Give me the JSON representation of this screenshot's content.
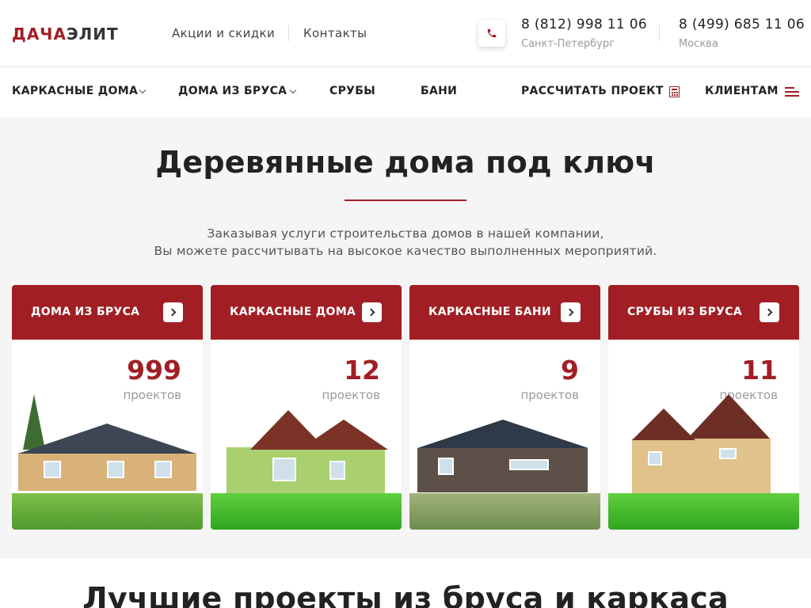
{
  "header": {
    "logo_part1": "ДАЧА",
    "logo_part2": "ЭЛИТ",
    "links": [
      "Акции и скидки",
      "Контакты"
    ],
    "phones": [
      {
        "number": "8 (812) 998 11 06",
        "city": "Санкт-Петербург"
      },
      {
        "number": "8 (499) 685 11 06",
        "city": "Москва"
      }
    ]
  },
  "nav": {
    "items": [
      "КАРКАСНЫЕ ДОМА",
      "ДОМА ИЗ БРУСА",
      "СРУБЫ",
      "БАНИ",
      "РАССЧИТАТЬ ПРОЕКТ",
      "КЛИЕНТАМ"
    ]
  },
  "hero": {
    "title": "Деревянные дома под ключ",
    "subtitle_line1": "Заказывая услуги строительства домов в нашей компании,",
    "subtitle_line2": "Вы можете рассчитывать на высокое качество выполненных мероприятий."
  },
  "cards": [
    {
      "title": "ДОМА ИЗ БРУСА",
      "count": "999",
      "unit": "проектов"
    },
    {
      "title": "КАРКАСНЫЕ ДОМА",
      "count": "12",
      "unit": "проектов"
    },
    {
      "title": "КАРКАСНЫЕ БАНИ",
      "count": "9",
      "unit": "проектов"
    },
    {
      "title": "СРУБЫ ИЗ БРУСА",
      "count": "11",
      "unit": "проектов"
    }
  ],
  "next_section": {
    "title": "Лучшие проекты из бруса и каркаса"
  },
  "colors": {
    "accent": "#a11f24",
    "background_light": "#f5f5f5"
  },
  "icons": [
    "phone-icon",
    "chevron-down-icon",
    "calculator-icon",
    "menu-icon",
    "chevron-right-icon"
  ]
}
